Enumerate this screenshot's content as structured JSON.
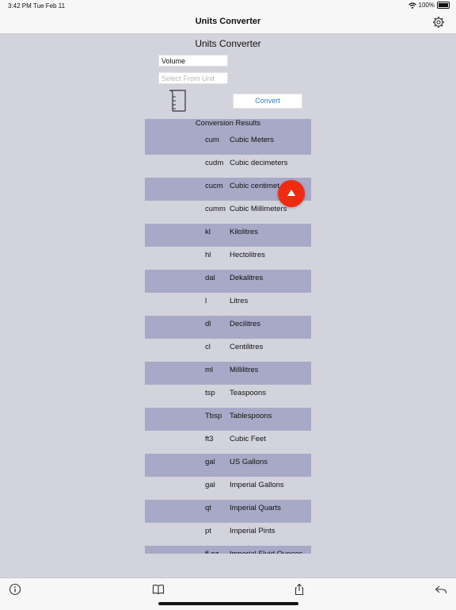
{
  "status": {
    "time": "3:42 PM",
    "date": "Tue Feb 11",
    "battery": "100%"
  },
  "nav": {
    "title": "Units Converter",
    "settings_icon": "gear-icon"
  },
  "form": {
    "heading": "Units Converter",
    "category_value": "Volume",
    "from_unit_placeholder": "Select From Unit",
    "convert_label": "Convert",
    "category_icon": "beaker-icon"
  },
  "results": {
    "header": "Conversion Results",
    "rows": [
      {
        "abbr": "cum",
        "name": "Cubic Meters"
      },
      {
        "abbr": "cudm",
        "name": "Cubic decimeters"
      },
      {
        "abbr": "cucm",
        "name": "Cubic centimet"
      },
      {
        "abbr": "cumm",
        "name": "Cubic Millimeters"
      },
      {
        "abbr": "kl",
        "name": "Kilolitres"
      },
      {
        "abbr": "hl",
        "name": "Hectolitres"
      },
      {
        "abbr": "dal",
        "name": "Dekalitres"
      },
      {
        "abbr": "l",
        "name": "Litres"
      },
      {
        "abbr": "dl",
        "name": "Decilitres"
      },
      {
        "abbr": "cl",
        "name": "Centilitres"
      },
      {
        "abbr": "ml",
        "name": "Millilitres"
      },
      {
        "abbr": "tsp",
        "name": "Teaspoons"
      },
      {
        "abbr": "Tbsp",
        "name": "Tablespoons"
      },
      {
        "abbr": "ft3",
        "name": "Cubic Feet"
      },
      {
        "abbr": "gal",
        "name": "US Gallons"
      },
      {
        "abbr": "gal",
        "name": "Imperial Gallons"
      },
      {
        "abbr": "qt",
        "name": "Imperial Quarts"
      },
      {
        "abbr": "pt",
        "name": "Imperial Pints"
      },
      {
        "abbr": "fl.oz",
        "name": "Imperial Fluid Ounces"
      }
    ]
  },
  "toolbar": {
    "icons": [
      "info-icon",
      "book-icon",
      "share-icon",
      "back-arrow-icon"
    ]
  },
  "fab": {
    "icon": "triangle-up-icon"
  }
}
